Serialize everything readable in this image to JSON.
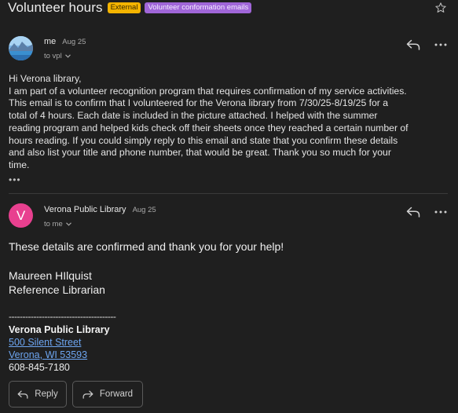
{
  "subject": "Volunteer hours",
  "chips": {
    "external": "External",
    "label": "Volunteer conformation emails"
  },
  "icons": {
    "star": "star-icon",
    "reply": "reply-icon",
    "more": "more-icon",
    "forward": "forward-icon"
  },
  "message1": {
    "sender": "me",
    "date": "Aug 25",
    "to": "to vpl",
    "greeting": "Hi Verona library,",
    "lines": [
      "I am part of a volunteer recognition program that requires confirmation of my service activities.",
      "This email is to confirm that I volunteered for the Verona library from 7/30/25-8/19/25 for a",
      "total of 4 hours. Each date is included in the picture attached. I helped with the summer",
      "reading program and helped kids check off their sheets once they reached a certain number of",
      "hours reading. If you could simply reply to this email and state that you confirm these details",
      "and also list your title and phone number, that would be great. Thank you so much for your",
      "time."
    ],
    "trimmed": "•••"
  },
  "message2": {
    "avatar_letter": "V",
    "avatar_color": "#e8408f",
    "sender": "Verona Public Library",
    "date": "Aug 25",
    "to": "to me",
    "body": "These details are confirmed and thank you for your help!",
    "name": "Maureen HIlquist",
    "title": "Reference Librarian",
    "sig_rule": "---------------------------------------",
    "org": "Verona Public Library",
    "street": "500 Silent Street",
    "city": "Verona, WI 53593",
    "phone": "608-845-7180"
  },
  "actions": {
    "reply": "Reply",
    "forward": "Forward"
  },
  "colors": {
    "background": "#1f1f1f",
    "link": "#6da5f0",
    "external_chip": "#f4b400",
    "label_chip": "#a066d8"
  }
}
